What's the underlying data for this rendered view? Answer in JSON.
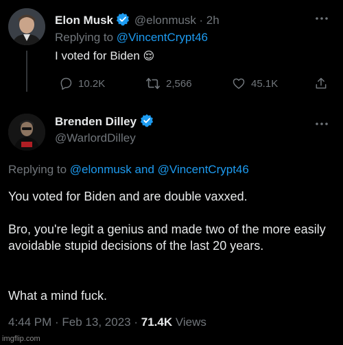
{
  "tweet1": {
    "name": "Elon Musk",
    "handle": "@elonmusk",
    "time": "· 2h",
    "replying_prefix": "Replying to",
    "replying_to": "@VincentCrypt46",
    "text": "I voted for Biden",
    "emoji": "😌",
    "actions": {
      "replies": "10.2K",
      "retweets": "2,566",
      "likes": "45.1K"
    }
  },
  "tweet2": {
    "name": "Brenden Dilley",
    "handle": "@WarlordDilley",
    "replying_prefix": "Replying to",
    "replying_to_1": "@elonmusk",
    "replying_and": "and",
    "replying_to_2": "@VincentCrypt46",
    "paragraphs": [
      "You voted for Biden and are double vaxxed.",
      "Bro, you're legit a genius and made two of the more easily avoidable stupid decisions of the last 20 years.",
      "What a mind fuck."
    ],
    "timestamp": "4:44 PM · Feb 13, 2023 ·",
    "views_count": "71.4K",
    "views_label": "Views"
  },
  "watermark": "imgflip.com",
  "icons": {
    "verified": "verified-badge-icon",
    "more": "more-dots-icon",
    "reply": "reply-icon",
    "retweet": "retweet-icon",
    "like": "heart-icon",
    "share": "share-icon"
  },
  "colors": {
    "background": "#000000",
    "text": "#e7e9ea",
    "muted": "#71767b",
    "accent": "#1d9bf0"
  }
}
